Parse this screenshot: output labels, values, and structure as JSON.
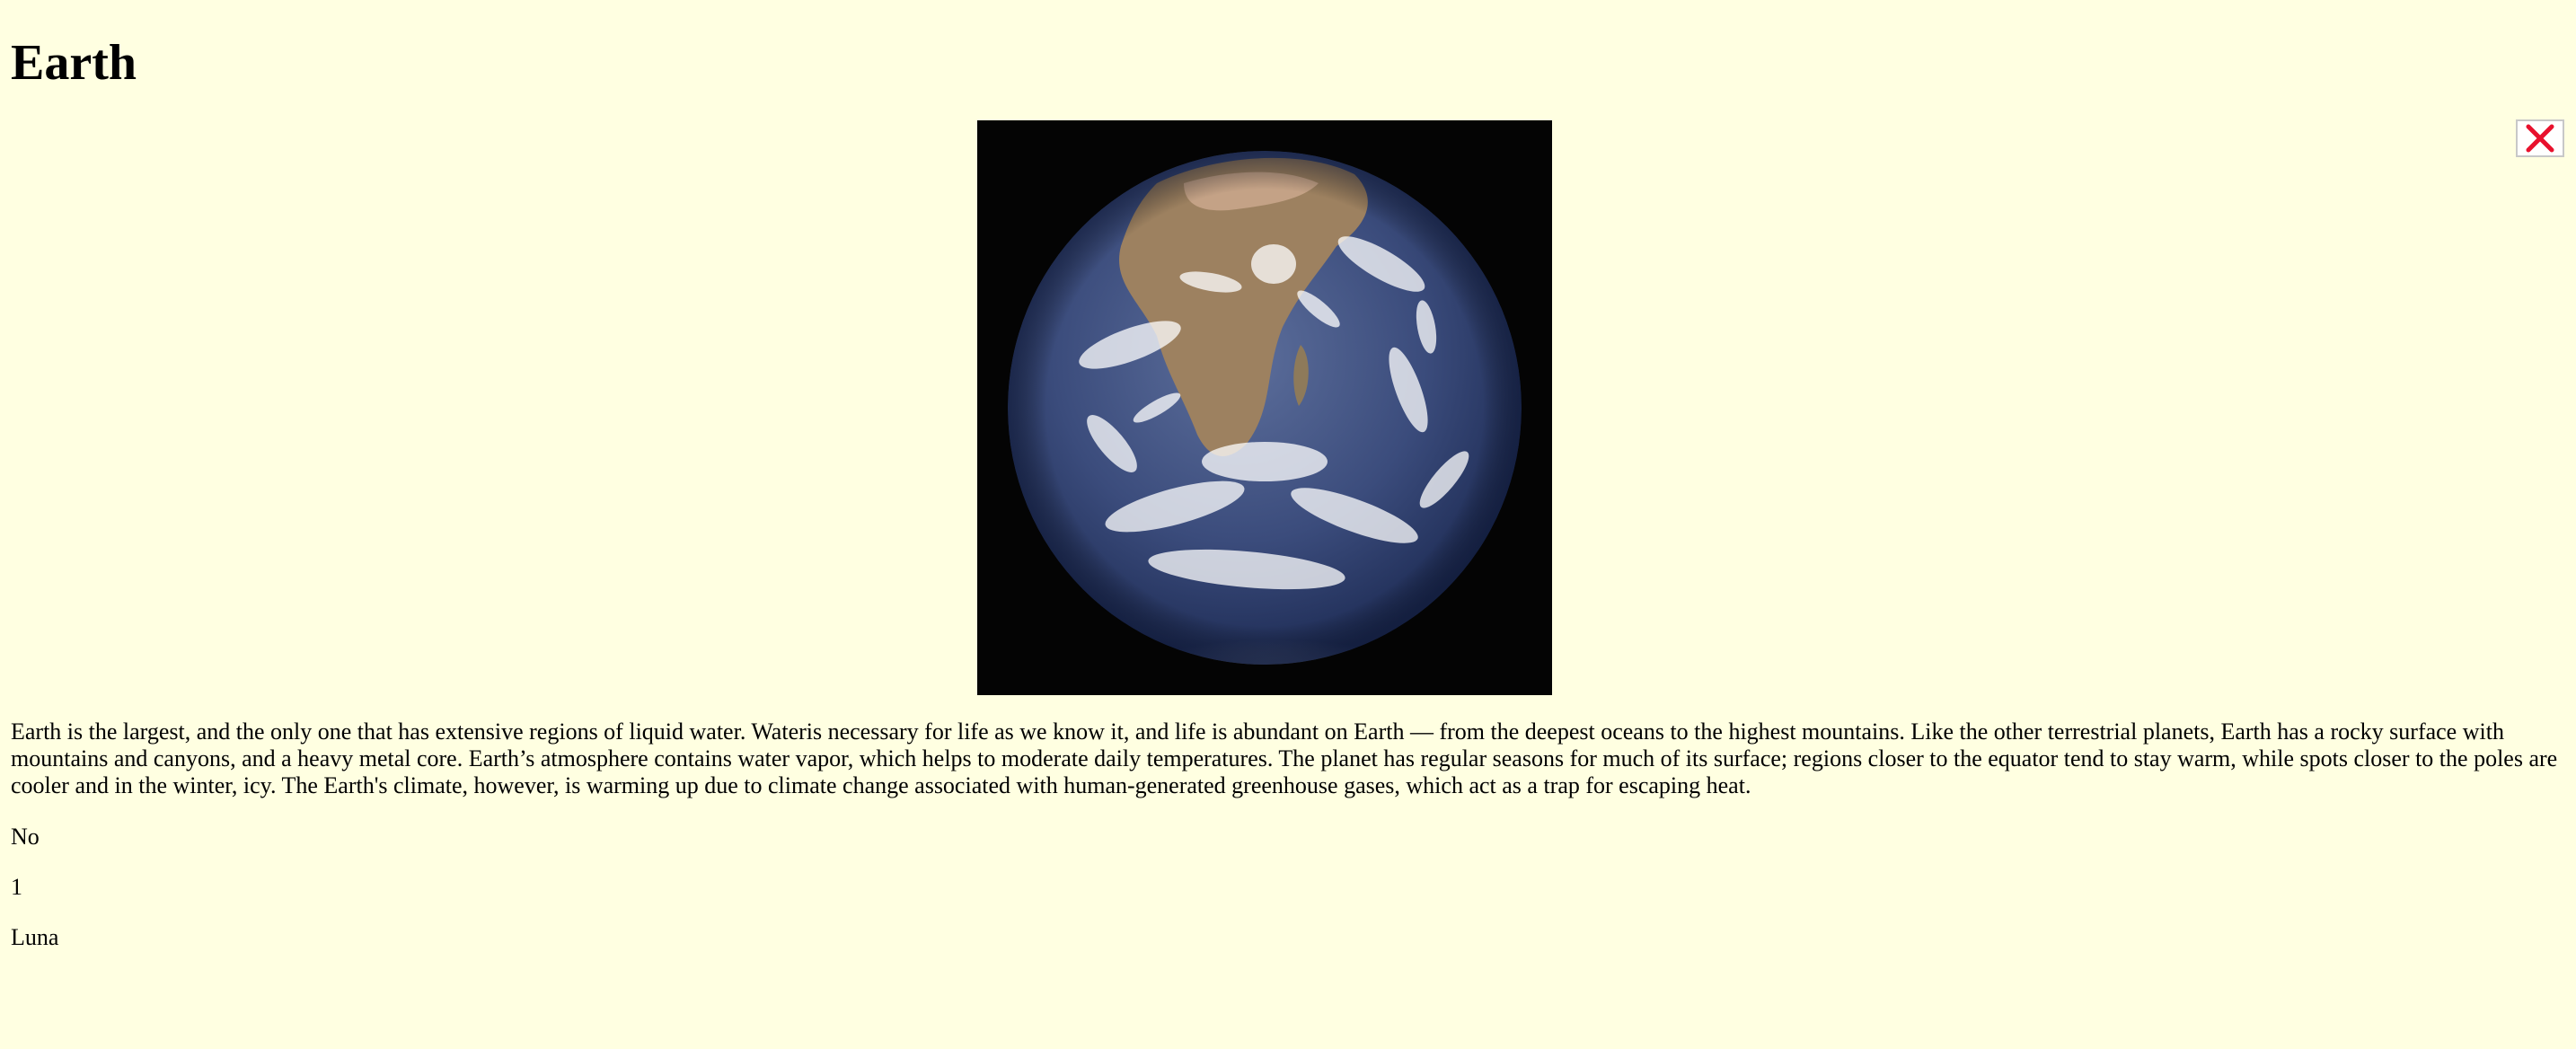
{
  "planet": {
    "title": "Earth",
    "image_alt": "Photograph of planet Earth from space",
    "description": "Earth is the largest, and the only one that has extensive regions of liquid water. Wateris necessary for life as we know it, and life is abundant on Earth — from the deepest oceans to the highest mountains. Like the other terrestrial planets, Earth has a rocky surface with mountains and canyons, and a heavy metal core. Earth’s atmosphere contains water vapor, which helps to moderate daily temperatures. The planet has regular seasons for much of its surface; regions closer to the equator tend to stay warm, while spots closer to the poles are cooler and in the winter, icy. The Earth's climate, however, is warming up due to climate change associated with human-generated greenhouse gases, which act as a trap for escaping heat.",
    "rings": "No",
    "moon_count": "1",
    "moon_names": "Luna"
  },
  "close_button": {
    "icon": "close-icon",
    "color": "#E8112D"
  },
  "colors": {
    "background": "#FFFFE1",
    "image_background": "#040404"
  }
}
